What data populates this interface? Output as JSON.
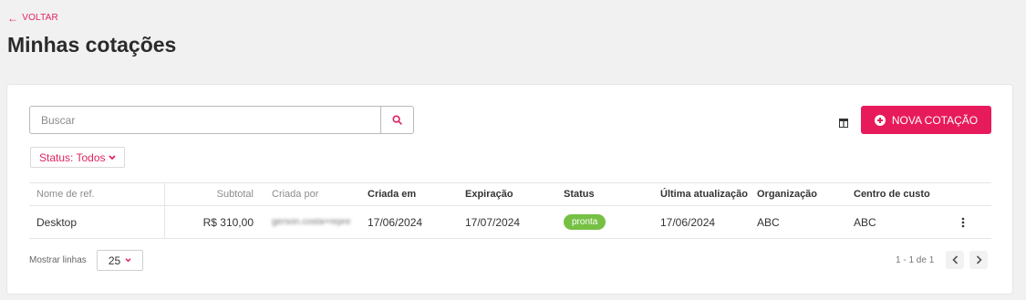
{
  "nav": {
    "back_label": "VOLTAR"
  },
  "page": {
    "title": "Minhas cotações"
  },
  "search": {
    "placeholder": "Buscar",
    "value": ""
  },
  "toolbar": {
    "new_quote_label": "NOVA COTAÇÃO"
  },
  "filters": {
    "status_label": "Status: Todos"
  },
  "table": {
    "columns": [
      "Nome de ref.",
      "Subtotal",
      "Criada por",
      "Criada em",
      "Expiração",
      "Status",
      "Última atualização",
      "Organização",
      "Centro de custo"
    ],
    "rows": [
      {
        "ref_name": "Desktop",
        "subtotal": "R$ 310,00",
        "created_by": "gerson.costa+repre",
        "created_at": "17/06/2024",
        "expiration": "17/07/2024",
        "status": "pronta",
        "last_update": "17/06/2024",
        "organization": "ABC",
        "cost_center": "ABC"
      }
    ]
  },
  "footer": {
    "rows_label": "Mostrar linhas",
    "rows_per_page": "25",
    "range_text": "1 - 1 de 1"
  },
  "colors": {
    "accent": "#e71b5c",
    "status_ready": "#76c043",
    "background": "#f1f1f2"
  },
  "icons": {
    "back": "arrow-left-icon",
    "search": "search-icon",
    "columns": "columns-icon",
    "add": "plus-circle-icon",
    "menu": "kebab-menu-icon",
    "prev": "chevron-left-icon",
    "next": "chevron-right-icon"
  }
}
